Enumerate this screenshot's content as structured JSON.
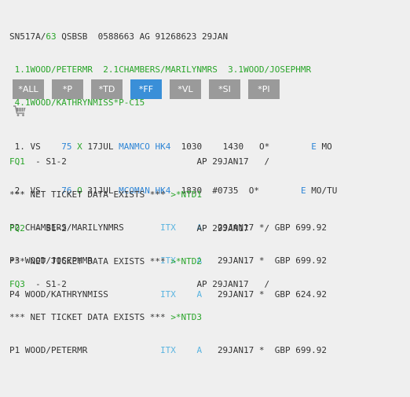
{
  "header": {
    "line1": "SN517A/",
    "line1_agent": "63",
    "line1_rest": " QSBSB  0588663 AG 91268623 29JAN",
    "line2": " 1.1WOOD/PETERMR  2.1CHAMBERS/MARILYNMRS  3.1WOOD/JOSEPHMR",
    "line3": " 4.1WOOD/KATHRYNMISS*P-C15"
  },
  "segments": [
    {
      "num": " 1.",
      "airline": " VS   ",
      "flight": " 75",
      "cls": " X",
      "date": " 17JUL",
      "route": " MANMCO",
      "status": " HK4",
      "dep": "  1030",
      "arr": "    1430",
      "arrflag": "   O*",
      "eticket": "        E",
      "days": " MO"
    },
    {
      "num": " 2.",
      "airline": " VS   ",
      "flight": " 76",
      "cls": " O",
      "date": " 31JUL",
      "route": " MCOMAN",
      "status": " HK4",
      "dep": "  1830",
      "arr": "  #0735",
      "arrflag": "  O*",
      "eticket": "        E",
      "days": " MO/TU"
    }
  ],
  "toolbar": {
    "buttons": [
      {
        "label": "*ALL",
        "active": false
      },
      {
        "label": "*P",
        "active": false
      },
      {
        "label": "*TD",
        "active": false
      },
      {
        "label": "*FF",
        "active": true
      },
      {
        "label": "*VL",
        "active": false
      },
      {
        "label": "*SI",
        "active": false
      },
      {
        "label": "*PI",
        "active": false
      }
    ],
    "cart_icon": "shopping-cart-icon"
  },
  "fares": [
    {
      "id": "FQ1",
      "seg": "  - S1-2",
      "ap": "AP 29JAN17   /",
      "notice": "*** NET TICKET DATA EXISTS *** ",
      "link": ">*NTD1",
      "rows": [
        {
          "pax": "P2 CHAMBERS/MARILYNMRS       ",
          "fare": "ITX",
          "type": "A",
          "date": "29JAN17 *",
          "amount": "GBP 699.92"
        },
        {
          "pax": "P3 WOOD/JOSEPHMR             ",
          "fare": "ITX",
          "type": "A",
          "date": "29JAN17 *",
          "amount": "GBP 699.92"
        }
      ]
    },
    {
      "id": "FQ2",
      "seg": "  - S1-2",
      "ap": "AP 29JAN17   /",
      "notice": "*** NET TICKET DATA EXISTS *** ",
      "link": ">*NTD2",
      "rows": [
        {
          "pax": "P4 WOOD/KATHRYNMISS          ",
          "fare": "ITX",
          "type": "A",
          "date": "29JAN17 *",
          "amount": "GBP 624.92"
        }
      ]
    },
    {
      "id": "FQ3",
      "seg": "  - S1-2",
      "ap": "AP 29JAN17   /",
      "notice": "*** NET TICKET DATA EXISTS *** ",
      "link": ">*NTD3",
      "rows": [
        {
          "pax": "P1 WOOD/PETERMR              ",
          "fare": "ITX",
          "type": "A",
          "date": "29JAN17 *",
          "amount": "GBP 699.92"
        }
      ]
    }
  ],
  "colors": {
    "green": "#2aa52a",
    "blue": "#2f86d6",
    "light_blue": "#5ab4e0",
    "button_gray": "#9a9a9a",
    "button_active": "#3a8fd8"
  }
}
